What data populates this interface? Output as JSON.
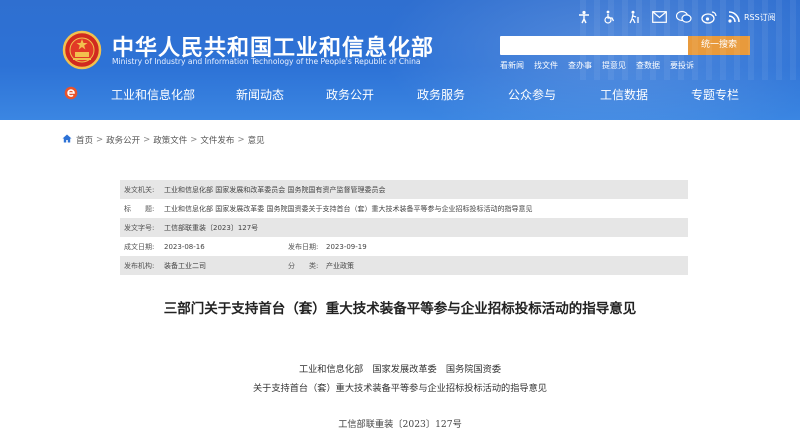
{
  "header": {
    "title": "中华人民共和国工业和信息化部",
    "subtitle": "Ministry of Industry and Information Technology of the People's Republic of China",
    "rss_label": "RSS订阅",
    "top_icons": [
      "accessibility-icon",
      "wheelchair-icon",
      "elder-mode-icon",
      "mail-icon",
      "wechat-icon",
      "weibo-icon",
      "rss-icon"
    ],
    "search": {
      "placeholder": "",
      "button_label": "统一搜索"
    },
    "quick_links": [
      "看新闻",
      "找文件",
      "查办事",
      "提意见",
      "查数据",
      "要投诉"
    ]
  },
  "nav": {
    "items": [
      "工业和信息化部",
      "新闻动态",
      "政务公开",
      "政务服务",
      "公众参与",
      "工信数据",
      "专题专栏"
    ]
  },
  "breadcrumb": [
    "首页",
    "政务公开",
    "政策文件",
    "文件发布",
    "意见"
  ],
  "meta": {
    "issuer_label": "发文机关:",
    "issuer": "工业和信息化部 国家发展和改革委员会 国务院国有资产监督管理委员会",
    "title_label": "标　　题:",
    "title": "工业和信息化部 国家发展改革委 国务院国资委关于支持首台（套）重大技术装备平等参与企业招标投标活动的指导意见",
    "docno_label": "发文字号:",
    "docno": "工信部联重装〔2023〕127号",
    "created_label": "成文日期:",
    "created": "2023-08-16",
    "published_label": "发布日期:",
    "published": "2023-09-19",
    "org_label": "发布机构:",
    "org": "装备工业二司",
    "category_label": "分　　类:",
    "category": "产业政策"
  },
  "article": {
    "title": "三部门关于支持首台（套）重大技术装备平等参与企业招标投标活动的指导意见",
    "issuers": "工业和信息化部　国家发展改革委　国务院国资委",
    "subtitle": "关于支持首台（套）重大技术装备平等参与企业招标投标活动的指导意见",
    "docnum": "工信部联重装〔2023〕127号"
  },
  "colors": {
    "header_blue": "#2d72d6",
    "search_button": "#e89a3c",
    "meta_shade": "#e6e6e6"
  }
}
